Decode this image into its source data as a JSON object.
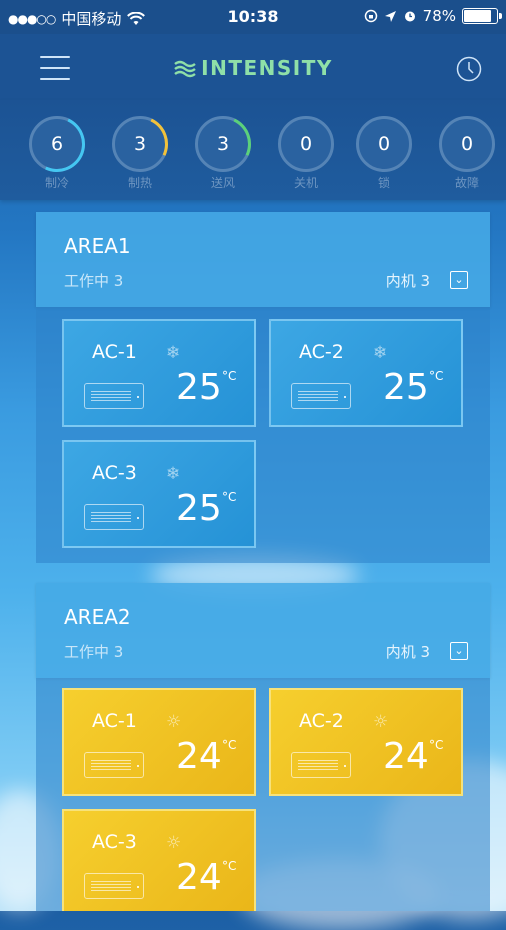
{
  "status_bar": {
    "signal": "●●●○○",
    "carrier": "中国移动",
    "wifi_icon": "wifi-icon",
    "time": "10:38",
    "battery_percent": "78%",
    "battery_level": 0.78
  },
  "header": {
    "brand": "INTENSITY",
    "menu_icon": "hamburger-menu-icon",
    "history_icon": "clock-icon",
    "brand_color": "#8fe0a8"
  },
  "stats": [
    {
      "count": "6",
      "label": "制冷",
      "color": "#44c7f2"
    },
    {
      "count": "3",
      "label": "制热",
      "color": "#f2c23a"
    },
    {
      "count": "3",
      "label": "送风",
      "color": "#5bd17a"
    },
    {
      "count": "0",
      "label": "关机"
    },
    {
      "count": "0",
      "label": "锁"
    },
    {
      "count": "0",
      "label": "故障"
    }
  ],
  "areas": [
    {
      "name": "AREA1",
      "working": "工作中 3",
      "units": "内机 3",
      "devices": [
        {
          "name": "AC-1",
          "mode": "cool",
          "mode_icon": "snowflake-icon",
          "temp": "25",
          "unit": "°C"
        },
        {
          "name": "AC-2",
          "mode": "cool",
          "mode_icon": "snowflake-icon",
          "temp": "25",
          "unit": "°C"
        },
        {
          "name": "AC-3",
          "mode": "cool",
          "mode_icon": "snowflake-icon",
          "temp": "25",
          "unit": "°C"
        }
      ]
    },
    {
      "name": "AREA2",
      "working": "工作中 3",
      "units": "内机 3",
      "devices": [
        {
          "name": "AC-1",
          "mode": "heat",
          "mode_icon": "sun-icon",
          "temp": "24",
          "unit": "°C"
        },
        {
          "name": "AC-2",
          "mode": "heat",
          "mode_icon": "sun-icon",
          "temp": "24",
          "unit": "°C"
        },
        {
          "name": "AC-3",
          "mode": "heat",
          "mode_icon": "sun-icon",
          "temp": "24",
          "unit": "°C"
        }
      ]
    }
  ]
}
